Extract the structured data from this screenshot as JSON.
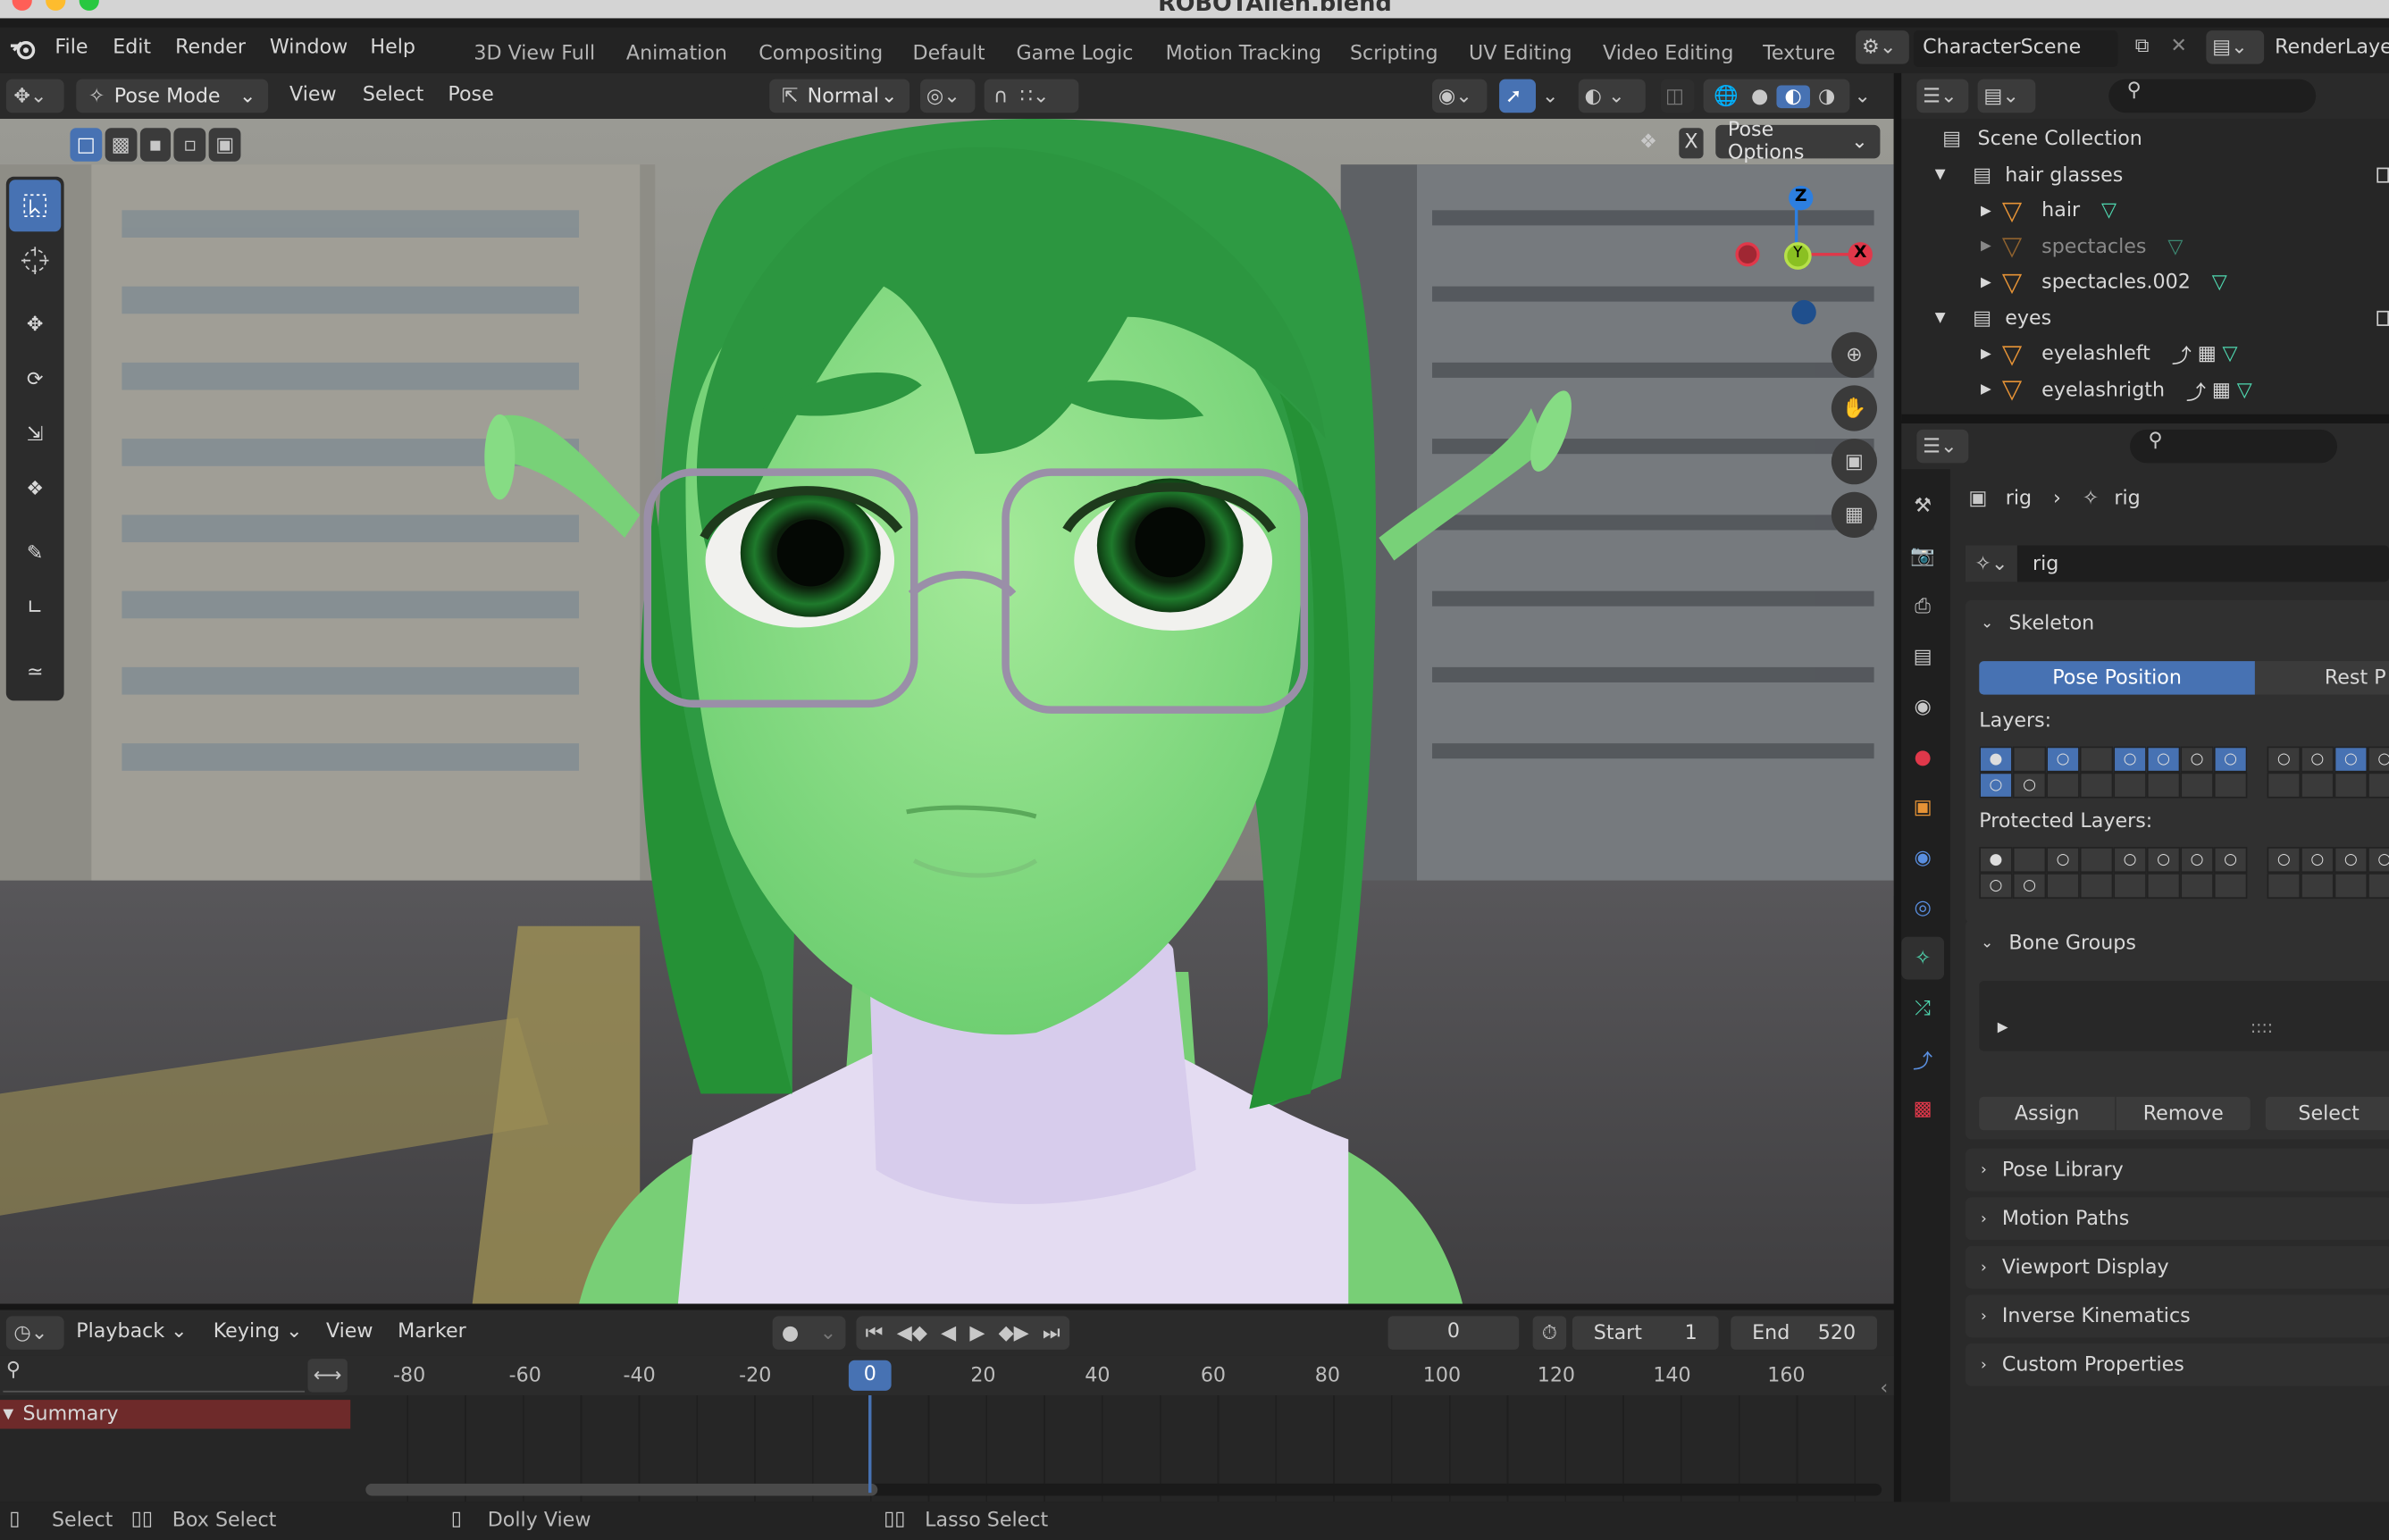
{
  "window": {
    "title": "ROBOTAlien.blend"
  },
  "topbar": {
    "menus": [
      "File",
      "Edit",
      "Render",
      "Window",
      "Help"
    ],
    "workspaces": [
      "3D View Full",
      "Animation",
      "Compositing",
      "Default",
      "Game Logic",
      "Motion Tracking",
      "Scripting",
      "UV Editing",
      "Video Editing",
      "Texture"
    ],
    "scene_name": "CharacterScene",
    "view_layer": "RenderLayer"
  },
  "viewport_header": {
    "mode": "Pose Mode",
    "menus": [
      "View",
      "Select",
      "Pose"
    ],
    "transform_orientation": "Normal",
    "pose_options": "Pose Options",
    "x_mirror": "X"
  },
  "gizmo": {
    "z": "Z",
    "y": "Y",
    "x": "X"
  },
  "outliner": {
    "root": "Scene Collection",
    "items": [
      {
        "label": "hair glasses",
        "type": "collection",
        "depth": 1
      },
      {
        "label": "hair",
        "type": "mesh",
        "depth": 2
      },
      {
        "label": "spectacles",
        "type": "mesh",
        "depth": 2,
        "dimmed": true
      },
      {
        "label": "spectacles.002",
        "type": "mesh",
        "depth": 2
      },
      {
        "label": "eyes",
        "type": "collection",
        "depth": 1
      },
      {
        "label": "eyelashleft",
        "type": "mesh",
        "depth": 2
      },
      {
        "label": "eyelashrigth",
        "type": "mesh",
        "depth": 2
      }
    ]
  },
  "properties": {
    "breadcrumb": [
      "rig",
      "rig"
    ],
    "data_name": "rig",
    "skeleton": {
      "title": "Skeleton",
      "pose_position": "Pose Position",
      "rest_position": "Rest P",
      "layers_label": "Layers:",
      "protected_label": "Protected Layers:"
    },
    "bone_groups": {
      "title": "Bone Groups",
      "grip": "::::",
      "assign": "Assign",
      "remove": "Remove",
      "select": "Select"
    },
    "collapsed_panels": [
      "Pose Library",
      "Motion Paths",
      "Viewport Display",
      "Inverse Kinematics",
      "Custom Properties"
    ]
  },
  "timeline": {
    "menus": [
      "Playback",
      "Keying",
      "View",
      "Marker"
    ],
    "current_frame": "0",
    "start_label": "Start",
    "start": "1",
    "end_label": "End",
    "end": "520",
    "ticks": [
      "-80",
      "-60",
      "-40",
      "-20",
      "0",
      "20",
      "40",
      "60",
      "80",
      "100",
      "120",
      "140",
      "160"
    ],
    "summary": "Summary"
  },
  "statusbar": {
    "items": [
      "Select",
      "Box Select",
      "Dolly View",
      "Lasso Select"
    ]
  },
  "colors": {
    "accent": "#4772b3",
    "axis_x": "#e0384a",
    "axis_y": "#8ac022",
    "axis_z": "#2d7fe0",
    "summary": "#6e2a2a"
  }
}
